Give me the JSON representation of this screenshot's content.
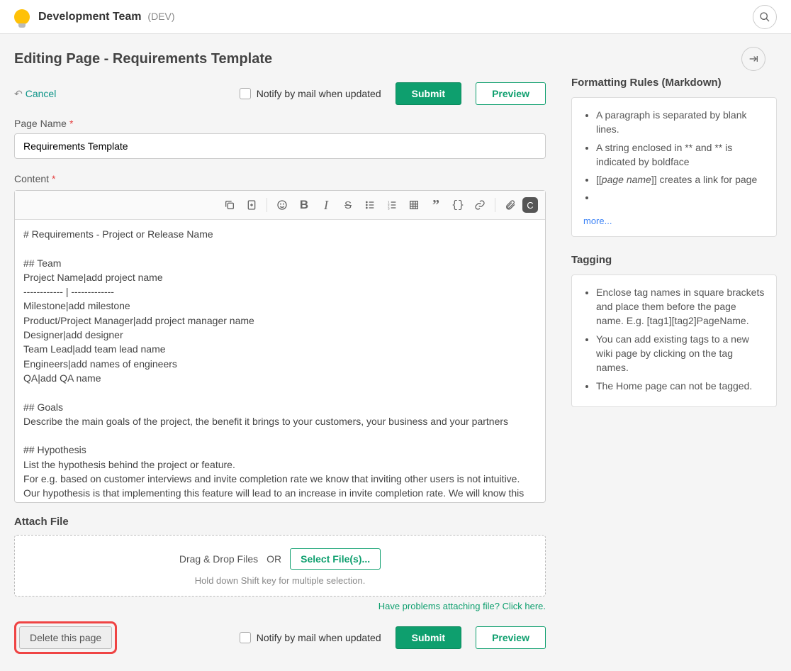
{
  "header": {
    "team_name": "Development Team",
    "team_code": "(DEV)"
  },
  "page": {
    "title": "Editing Page - Requirements Template",
    "cancel": "Cancel",
    "notify_label": "Notify by mail when updated",
    "submit": "Submit",
    "preview": "Preview"
  },
  "form": {
    "page_name_label": "Page Name",
    "page_name_value": "Requirements Template",
    "content_label": "Content",
    "content_value": "# Requirements - Project or Release Name\n\n## Team\nProject Name|add project name\n------------ | -------------\nMilestone|add milestone\nProduct/Project Manager|add project manager name\nDesigner|add designer\nTeam Lead|add team lead name\nEngineers|add names of engineers\nQA|add QA name\n\n## Goals\nDescribe the main goals of the project, the benefit it brings to your customers, your business and your partners\n\n## Hypothesis\nList the hypothesis behind the project or feature.\nFor e.g. based on customer interviews and invite completion rate we know that inviting other users is not intuitive. Our hypothesis is that implementing this feature will lead to an increase in invite completion rate. We will know this when we see an increase in invite completion rate"
  },
  "attach": {
    "heading": "Attach File",
    "dragdrop": "Drag & Drop Files",
    "or": "OR",
    "select": "Select File(s)...",
    "hint": "Hold down Shift key for multiple selection.",
    "problem": "Have problems attaching file? Click here."
  },
  "bottom": {
    "delete": "Delete this page",
    "notify_label": "Notify by mail when updated",
    "submit": "Submit",
    "preview": "Preview"
  },
  "sidebar": {
    "formatting_heading": "Formatting Rules (Markdown)",
    "formatting_rules": [
      "A paragraph is separated by blank lines.",
      "A string enclosed in ** and ** is indicated by boldface",
      "[[page name]] creates a link for page",
      ""
    ],
    "more": "more...",
    "tagging_heading": "Tagging",
    "tagging_rules": [
      "Enclose tag names in square brackets and place them before the page name. E.g. [tag1][tag2]PageName.",
      "You can add existing tags to a new wiki page by clicking on the tag names.",
      "The Home page can not be tagged."
    ]
  }
}
